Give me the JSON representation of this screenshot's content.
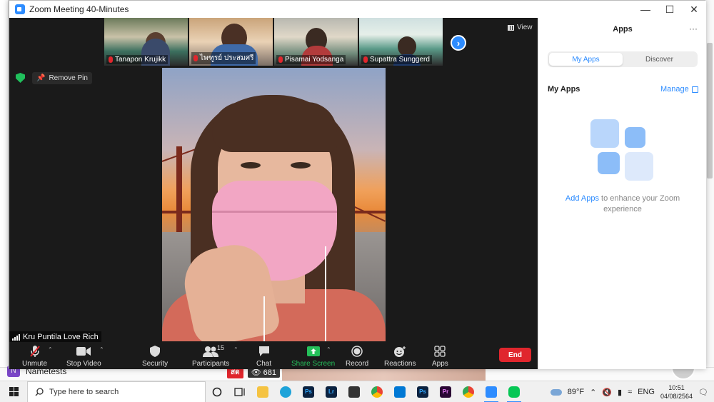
{
  "window": {
    "title": "Zoom Meeting 40-Minutes"
  },
  "participants": [
    {
      "name": "Tanapon Krujikk",
      "muted": true
    },
    {
      "name": "ไพฑูรย์ ประสมศรี",
      "muted": true
    },
    {
      "name": "Pisamai Yodsanga",
      "muted": true
    },
    {
      "name": "Supattra Sunggerd",
      "muted": true
    }
  ],
  "view_label": "View",
  "remove_pin_label": "Remove Pin",
  "active_speaker": "Kru Puntila Love Rich",
  "toolbar": {
    "unmute": "Unmute",
    "stop_video": "Stop Video",
    "security": "Security",
    "participants": "Participants",
    "participants_count": "15",
    "chat": "Chat",
    "share_screen": "Share Screen",
    "record": "Record",
    "reactions": "Reactions",
    "apps": "Apps",
    "end": "End"
  },
  "apps_panel": {
    "title": "Apps",
    "more": "···",
    "tabs": [
      "My Apps",
      "Discover"
    ],
    "heading": "My Apps",
    "manage": "Manage",
    "add_apps": "Add Apps",
    "message_rest": " to enhance your Zoom experience"
  },
  "background": {
    "nametests": "Nametests",
    "live": "สด",
    "views": "681"
  },
  "taskbar": {
    "search_placeholder": "Type here to search",
    "weather": "89°F",
    "language": "ENG",
    "time": "10:51",
    "date": "04/08/2564"
  },
  "colors": {
    "zoom_blue": "#2d8cff",
    "end_red": "#e0262d",
    "share_green": "#25c05a"
  }
}
